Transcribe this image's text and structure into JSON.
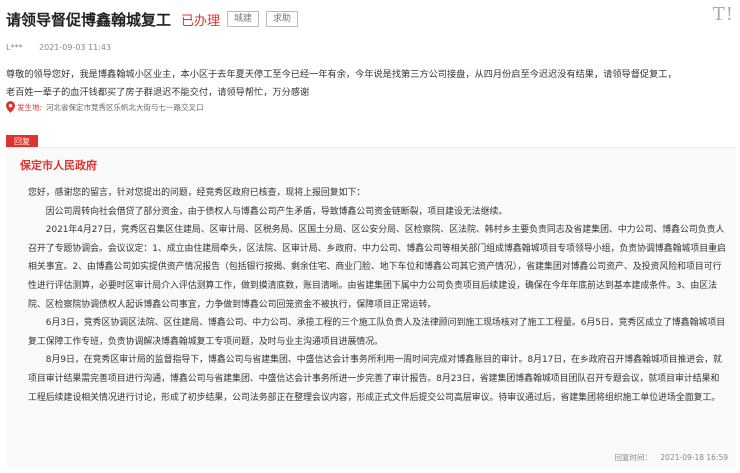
{
  "header": {
    "title": "请领导督促博鑫翰城复工",
    "status": "已办理",
    "tags": [
      "城建",
      "求助"
    ],
    "logo_text": "T!"
  },
  "meta": {
    "author": "L***",
    "time": "2021-09-03 11:43"
  },
  "message": {
    "lines": [
      "尊敬的领导您好，我是博鑫翰城小区业主，本小区于去年夏天停工至今已经一年有余，今年说是找第三方公司接盘，从四月份启至今迟迟没有结果，请领导督促复工，",
      "老百姓一辈子的血汗钱都买了房子群退迟不能交付，请领导帮忙，万分感谢"
    ]
  },
  "location": {
    "label": "发生地:",
    "value": "河北省保定市竞秀区乐帆北大街与七一路交叉口"
  },
  "reply": {
    "badge": "回复",
    "org": "保定市人民政府",
    "paragraphs": [
      "您好，感谢您的留言，针对您提出的问题，经竞秀区政府已核查，现将上报回复如下：",
      "因公司周转向社会借贷了部分资金，由于债权人与博鑫公司产生矛盾，导致博鑫公司资金链断裂，项目建设无法继续。",
      "2021年4月27日，竞秀区召集区住建局、区审计局、区税务局、区国土分局、区公安分局、区检察院、区法院、韩村乡主要负责同志及省建集团、中力公司、博鑫公司负责人召开了专题协调会。会议议定：1、成立由住建局牵头，区法院、区审计局、乡政府、中力公司、博鑫公司等相关部门组成博鑫翰城项目专项领导小组，负责协调博鑫翰城项目重启相关事宜。2、由博鑫公司如实提供资产情况报告（包括银行按揭、剩余住宅、商业门脸、地下车位和博鑫公司其它资产情况），省建集团对博鑫公司资产、及投资风险和项目可行性进行评估测算，必要时区审计局介入评估测算工作，做到摸清底数，账目清晰。由省建集团下属中力公司负责项目后续建设，确保在今年年底前达到基本建成条件。3、由区法院、区检察院协调债权人起诉博鑫公司事宜，力争做到博鑫公司回笼资金不被执行，保障项目正常运转。",
      "6月3日，竞秀区协调区法院、区住建局、博鑫公司、中力公司、承揽工程的三个施工队负责人及法律顾问到施工现场核对了施工工程量。6月5日，竞秀区成立了博鑫翰城项目复工保障工作专班，负责协调解决博鑫翰城复工专项问题，及时与业主沟通项目进展情况。",
      "8月9日，在竞秀区审计局的监督指导下，博鑫公司与省建集团、中盛信达会计事务所利用一周时间完成对博鑫账目的审计。8月17日，在乡政府召开博鑫翰城项目推进会，就项目审计结果需完善项目进行沟通，博鑫公司与省建集团、中盛信达会计事务所进一步完善了审计报告。8月23日，省建集团博鑫翰城项目团队召开专题会议，就项目审计结果和工程后续建设相关情况进行讨论，形成了初步结果，公司法务部正在整理会议内容，形成正式文件后提交公司高层审议。待审议通过后，省建集团将组织施工单位进场全面复工。"
    ],
    "time_label": "回复时间：",
    "time": "2021-09-18 16:59"
  }
}
